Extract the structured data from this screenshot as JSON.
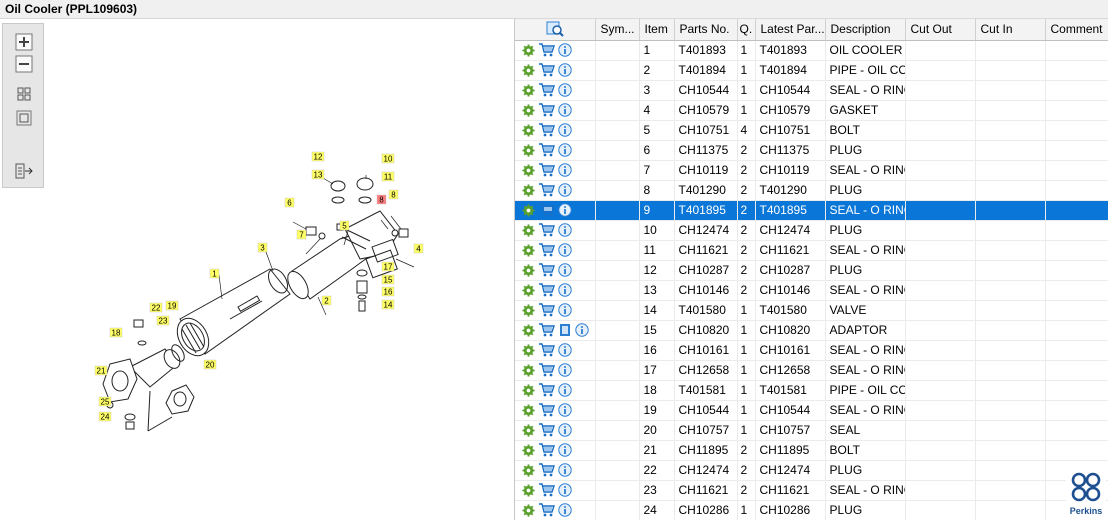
{
  "title": "Oil Cooler (PPL109603)",
  "toolbar": {
    "buttons": [
      "zoom-in",
      "zoom-out",
      "fit-all",
      "actual-size",
      "export-list"
    ]
  },
  "diagram_labels": [
    "1",
    "2",
    "3",
    "4",
    "5",
    "6",
    "7",
    "8",
    "8",
    "10",
    "11",
    "12",
    "13",
    "14",
    "15",
    "16",
    "17",
    "18",
    "19",
    "20",
    "21",
    "22",
    "23",
    "24",
    "25"
  ],
  "table": {
    "columns": [
      "",
      "Sym...",
      "Item",
      "Parts No.",
      "Q.",
      "Latest Par...",
      "Description",
      "Cut Out",
      "Cut In",
      "Comment"
    ],
    "rows": [
      {
        "item": "1",
        "part": "T401893",
        "qty": "1",
        "latest": "T401893",
        "desc": "OIL COOLER"
      },
      {
        "item": "2",
        "part": "T401894",
        "qty": "1",
        "latest": "T401894",
        "desc": "PIPE - OIL COO"
      },
      {
        "item": "3",
        "part": "CH10544",
        "qty": "1",
        "latest": "CH10544",
        "desc": "SEAL - O RING"
      },
      {
        "item": "4",
        "part": "CH10579",
        "qty": "1",
        "latest": "CH10579",
        "desc": "GASKET"
      },
      {
        "item": "5",
        "part": "CH10751",
        "qty": "4",
        "latest": "CH10751",
        "desc": "BOLT"
      },
      {
        "item": "6",
        "part": "CH11375",
        "qty": "2",
        "latest": "CH11375",
        "desc": "PLUG"
      },
      {
        "item": "7",
        "part": "CH10119",
        "qty": "2",
        "latest": "CH10119",
        "desc": "SEAL - O RING"
      },
      {
        "item": "8",
        "part": "T401290",
        "qty": "2",
        "latest": "T401290",
        "desc": "PLUG"
      },
      {
        "item": "9",
        "part": "T401895",
        "qty": "2",
        "latest": "T401895",
        "desc": "SEAL - O RING",
        "selected": true
      },
      {
        "item": "10",
        "part": "CH12474",
        "qty": "2",
        "latest": "CH12474",
        "desc": "PLUG"
      },
      {
        "item": "11",
        "part": "CH11621",
        "qty": "2",
        "latest": "CH11621",
        "desc": "SEAL - O RING"
      },
      {
        "item": "12",
        "part": "CH10287",
        "qty": "2",
        "latest": "CH10287",
        "desc": "PLUG"
      },
      {
        "item": "13",
        "part": "CH10146",
        "qty": "2",
        "latest": "CH10146",
        "desc": "SEAL - O RING"
      },
      {
        "item": "14",
        "part": "T401580",
        "qty": "1",
        "latest": "T401580",
        "desc": "VALVE"
      },
      {
        "item": "15",
        "part": "CH10820",
        "qty": "1",
        "latest": "CH10820",
        "desc": "ADAPTOR",
        "doc": true
      },
      {
        "item": "16",
        "part": "CH10161",
        "qty": "1",
        "latest": "CH10161",
        "desc": "SEAL - O RING"
      },
      {
        "item": "17",
        "part": "CH12658",
        "qty": "1",
        "latest": "CH12658",
        "desc": "SEAL - O RING"
      },
      {
        "item": "18",
        "part": "T401581",
        "qty": "1",
        "latest": "T401581",
        "desc": "PIPE - OIL COO"
      },
      {
        "item": "19",
        "part": "CH10544",
        "qty": "1",
        "latest": "CH10544",
        "desc": "SEAL - O RING"
      },
      {
        "item": "20",
        "part": "CH10757",
        "qty": "1",
        "latest": "CH10757",
        "desc": "SEAL"
      },
      {
        "item": "21",
        "part": "CH11895",
        "qty": "2",
        "latest": "CH11895",
        "desc": "BOLT"
      },
      {
        "item": "22",
        "part": "CH12474",
        "qty": "2",
        "latest": "CH12474",
        "desc": "PLUG"
      },
      {
        "item": "23",
        "part": "CH11621",
        "qty": "2",
        "latest": "CH11621",
        "desc": "SEAL - O RING"
      },
      {
        "item": "24",
        "part": "CH10286",
        "qty": "1",
        "latest": "CH10286",
        "desc": "PLUG"
      }
    ]
  },
  "brand": "Perkins",
  "colors": {
    "selected_row": "#0a76d8",
    "label_bg": "#ffff66",
    "highlight_label": "#ff8080",
    "gear": "#5aa02c",
    "cart": "#1a6fc4",
    "info": "#2d7fd3"
  }
}
